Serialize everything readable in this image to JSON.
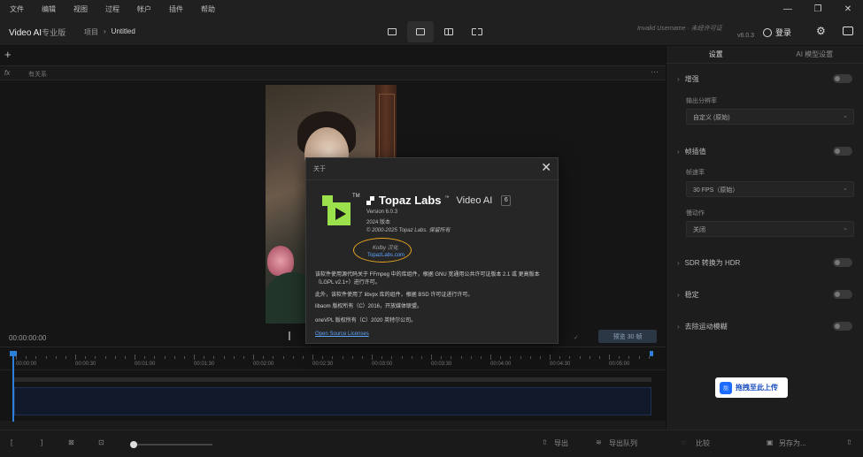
{
  "menubar": {
    "items": [
      "文件",
      "编辑",
      "视图",
      "过程",
      "帐户",
      "插件",
      "帮助"
    ]
  },
  "window_controls": {
    "minimize": "—",
    "maximize": "❐",
    "close": "✕"
  },
  "toolbar": {
    "app_title": "Video AI",
    "edition": "专业版",
    "breadcrumb_root": "项目",
    "breadcrumb_sep": "›",
    "breadcrumb_current": "Untitled",
    "user_info": "Invalid Username · 未经许可证",
    "version": "v6.0.3",
    "login_label": "登录"
  },
  "main": {
    "add_label": "+",
    "filter_fx": "fx",
    "filter_label": "有关系",
    "more_label": "···",
    "time": "00:00:00:00",
    "quality_dropdown": "✓",
    "export_label": "预览 30 帧"
  },
  "timeline": {
    "ticks": [
      "00:00:00",
      "00:00:30",
      "00:01:00",
      "00:01:30",
      "00:02:00",
      "00:02:30",
      "00:03:00",
      "00:03:30",
      "00:04:00",
      "00:04:30",
      "00:05:00"
    ]
  },
  "bottom": {
    "bracket_in": "[",
    "bracket_out": "]",
    "crop": "⊠",
    "mark": "⊡",
    "import_label": "导出",
    "batch_label": "导出队列",
    "compare_label": "比较",
    "save_label": "另存为...",
    "share_label": "⇧"
  },
  "right_panel": {
    "tabs": [
      "设置",
      "AI 模型设置"
    ],
    "sections": [
      {
        "title": "增强",
        "label": "输出分辨率",
        "select": "自定义 (原始)"
      },
      {
        "title": "帧插值",
        "label": "帧速率",
        "select": "30 FPS（原始）",
        "label2": "慢动作",
        "select2": "关闭"
      },
      {
        "title": "SDR 转换为 HDR"
      },
      {
        "title": "稳定"
      },
      {
        "title": "去除运动模糊"
      }
    ]
  },
  "baidu": {
    "label": "拖拽至此上传",
    "icon": "ஐ"
  },
  "modal": {
    "title": "关于",
    "close": "✕",
    "brand": "Topaz Labs",
    "brand_tm": "™",
    "product": "Video AI",
    "product_version_badge": "6",
    "logo_tm": "TM",
    "version_line": "Version 6.0.3",
    "year_line": "2024 版本",
    "copyright": "© 2000-2025 Topaz Labs. 保留所有",
    "by_label": "Kolby 汉化",
    "site_link": "TopazLabs.com",
    "license_1": "该软件使用源代码关于 FFmpeg 中的库组件，根据 GNU 宽通用公共许可证版本 2.1 或 更高版本（LGPL v2.1+）进行许可。",
    "license_2": "此外，该软件使用了 libvpx 库的组件，根据 BSD 许可证进行许可。",
    "license_3": "libaom 版权所有（C）2016，开放媒体联盟。",
    "license_4": "oneVPL 版权所有（C）2020 英特尔公司。",
    "license_link": "Open Source Licenses"
  },
  "colors": {
    "accent_green": "#9be14b",
    "link_blue": "#5ea3ff",
    "highlight_orange": "#e8a51e",
    "playhead_blue": "#2d7fd8"
  },
  "icons": [
    "gear-icon",
    "user-icon",
    "panel-toggle-icon",
    "play-icon",
    "compare-icon",
    "export-icon",
    "stack-icon",
    "save-icon",
    "share-icon"
  ]
}
